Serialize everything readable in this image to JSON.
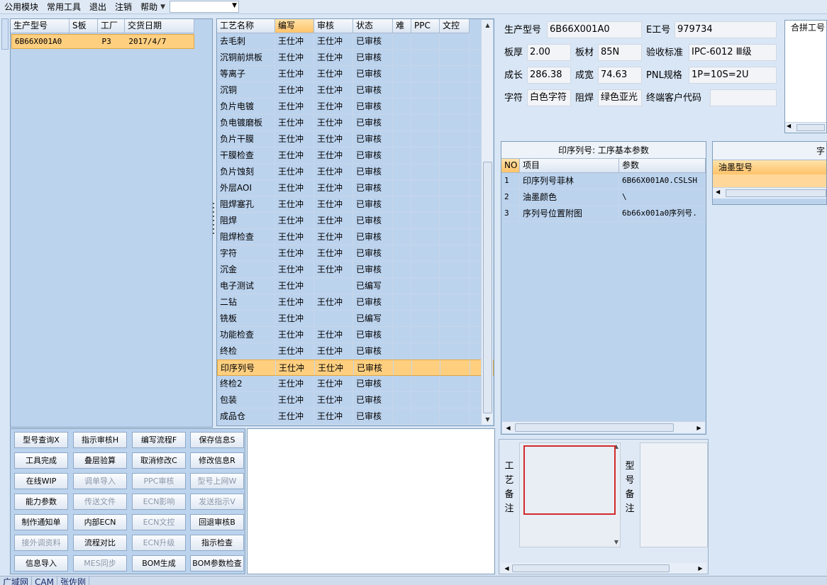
{
  "menu": {
    "items": [
      "公用模块",
      "常用工具",
      "退出",
      "注销",
      "帮助"
    ],
    "combo_value": ""
  },
  "order_list": {
    "headers": [
      "生产型号",
      "S板",
      "工厂",
      "交货日期"
    ],
    "rows": [
      {
        "model": "6B66X001A0",
        "s_board": "",
        "factory": "P3",
        "date": "2017/4/7"
      }
    ]
  },
  "process_grid": {
    "headers": [
      "工艺名称",
      "编写",
      "审核",
      "状态",
      "难",
      "PPC",
      "文控"
    ],
    "rows": [
      {
        "name": "去毛刺",
        "writer": "王仕冲",
        "reviewer": "王仕冲",
        "status": "已审核"
      },
      {
        "name": "沉铜前烘板",
        "writer": "王仕冲",
        "reviewer": "王仕冲",
        "status": "已审核"
      },
      {
        "name": "等离子",
        "writer": "王仕冲",
        "reviewer": "王仕冲",
        "status": "已审核"
      },
      {
        "name": "沉铜",
        "writer": "王仕冲",
        "reviewer": "王仕冲",
        "status": "已审核"
      },
      {
        "name": "负片电镀",
        "writer": "王仕冲",
        "reviewer": "王仕冲",
        "status": "已审核"
      },
      {
        "name": "负电镀磨板",
        "writer": "王仕冲",
        "reviewer": "王仕冲",
        "status": "已审核"
      },
      {
        "name": "负片干膜",
        "writer": "王仕冲",
        "reviewer": "王仕冲",
        "status": "已审核"
      },
      {
        "name": "干膜检查",
        "writer": "王仕冲",
        "reviewer": "王仕冲",
        "status": "已审核"
      },
      {
        "name": "负片蚀刻",
        "writer": "王仕冲",
        "reviewer": "王仕冲",
        "status": "已审核"
      },
      {
        "name": "外层AOI",
        "writer": "王仕冲",
        "reviewer": "王仕冲",
        "status": "已审核"
      },
      {
        "name": "阻焊塞孔",
        "writer": "王仕冲",
        "reviewer": "王仕冲",
        "status": "已审核"
      },
      {
        "name": "阻焊",
        "writer": "王仕冲",
        "reviewer": "王仕冲",
        "status": "已审核"
      },
      {
        "name": "阻焊检查",
        "writer": "王仕冲",
        "reviewer": "王仕冲",
        "status": "已审核"
      },
      {
        "name": "字符",
        "writer": "王仕冲",
        "reviewer": "王仕冲",
        "status": "已审核"
      },
      {
        "name": "沉金",
        "writer": "王仕冲",
        "reviewer": "王仕冲",
        "status": "已审核"
      },
      {
        "name": "电子测试",
        "writer": "王仕冲",
        "reviewer": "",
        "status": "已编写"
      },
      {
        "name": "二钻",
        "writer": "王仕冲",
        "reviewer": "王仕冲",
        "status": "已审核"
      },
      {
        "name": "铣板",
        "writer": "王仕冲",
        "reviewer": "",
        "status": "已编写"
      },
      {
        "name": "功能检查",
        "writer": "王仕冲",
        "reviewer": "王仕冲",
        "status": "已审核"
      },
      {
        "name": "终检",
        "writer": "王仕冲",
        "reviewer": "王仕冲",
        "status": "已审核"
      },
      {
        "name": "印序列号",
        "writer": "王仕冲",
        "reviewer": "王仕冲",
        "status": "已审核",
        "selected": true
      },
      {
        "name": "终检2",
        "writer": "王仕冲",
        "reviewer": "王仕冲",
        "status": "已审核"
      },
      {
        "name": "包装",
        "writer": "王仕冲",
        "reviewer": "王仕冲",
        "status": "已审核"
      },
      {
        "name": "成品仓",
        "writer": "王仕冲",
        "reviewer": "王仕冲",
        "status": "已审核"
      }
    ]
  },
  "buttons": [
    [
      {
        "label": "型号查询X",
        "enabled": true
      },
      {
        "label": "指示审核H",
        "enabled": true
      },
      {
        "label": "编写流程F",
        "enabled": true
      },
      {
        "label": "保存信息S",
        "enabled": true
      }
    ],
    [
      {
        "label": "工具完成",
        "enabled": true
      },
      {
        "label": "叠层验算",
        "enabled": true
      },
      {
        "label": "取消修改C",
        "enabled": true
      },
      {
        "label": "修改信息R",
        "enabled": true
      }
    ],
    [
      {
        "label": "在线WIP",
        "enabled": true
      },
      {
        "label": "调单导入",
        "enabled": false
      },
      {
        "label": "PPC审核",
        "enabled": false
      },
      {
        "label": "型号上网W",
        "enabled": false
      }
    ],
    [
      {
        "label": "能力参数",
        "enabled": true
      },
      {
        "label": "传送文件",
        "enabled": false
      },
      {
        "label": "ECN影响",
        "enabled": false
      },
      {
        "label": "发送指示V",
        "enabled": false
      }
    ],
    [
      {
        "label": "制作通知单",
        "enabled": true
      },
      {
        "label": "内部ECN",
        "enabled": true
      },
      {
        "label": "ECN文控",
        "enabled": false
      },
      {
        "label": "回退审核B",
        "enabled": true
      }
    ],
    [
      {
        "label": "接外调资料",
        "enabled": false
      },
      {
        "label": "流程对比",
        "enabled": true
      },
      {
        "label": "ECN升级",
        "enabled": false
      },
      {
        "label": "指示检查",
        "enabled": true
      }
    ],
    [
      {
        "label": "信息导入",
        "enabled": true
      },
      {
        "label": "MES同步",
        "enabled": false
      },
      {
        "label": "BOM生成",
        "enabled": true
      },
      {
        "label": "BOM参数检查",
        "enabled": true
      }
    ]
  ],
  "info": {
    "model_label": "生产型号",
    "model_value": "6B66X001A0",
    "e_no_label": "E工号",
    "e_no_value": "979734",
    "thickness_label": "板厚",
    "thickness_value": "2.00",
    "material_label": "板材",
    "material_value": "85N",
    "standard_label": "验收标准",
    "standard_value": "IPC-6012 Ⅲ级",
    "length_label": "成长",
    "length_value": "286.38",
    "width_label": "成宽",
    "width_value": "74.63",
    "pnl_label": "PNL规格",
    "pnl_value": "1P=10S=2U",
    "char_label": "字符",
    "char_value": "白色字符",
    "mask_label": "阻焊",
    "mask_value": "绿色亚光",
    "customer_label": "终端客户代码",
    "customer_value": "",
    "merge_label": "合拼工号"
  },
  "params": {
    "title": "印序列号: 工序基本参数",
    "headers": [
      "NO",
      "项目",
      "参数"
    ],
    "rows": [
      {
        "no": "1",
        "item": "印序列号菲林",
        "value": "6B66X001A0.CSLSH"
      },
      {
        "no": "2",
        "item": "油墨颜色",
        "value": "\\"
      },
      {
        "no": "3",
        "item": "序列号位置附图",
        "value": "6b66x001a0序列号."
      }
    ]
  },
  "ink": {
    "title_partial": "字",
    "header": "油墨型号"
  },
  "remarks": {
    "craft_label": "工艺备注",
    "model_label": "型号备注"
  },
  "statusbar": [
    "广域网",
    "CAM",
    "张佐刚"
  ],
  "colors": {
    "selection": "#ffcf80",
    "panel": "#bcd3ee",
    "highlight_box": "#d22a2a"
  }
}
